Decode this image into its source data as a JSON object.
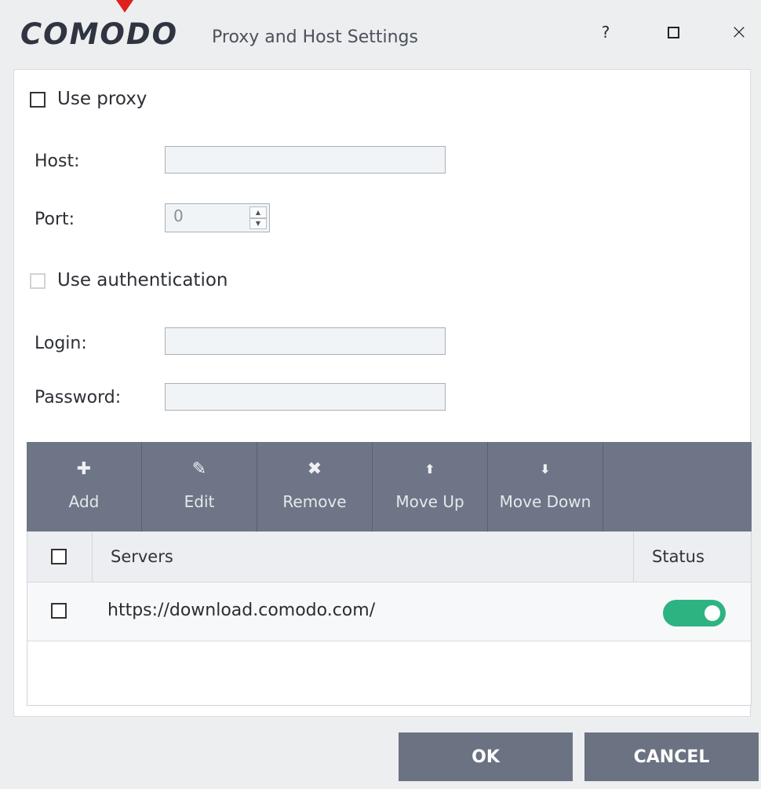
{
  "window": {
    "logo_text": "COMODO",
    "title": "Proxy and Host Settings",
    "help_label": "?",
    "close_label": "×"
  },
  "proxy": {
    "use_proxy_label": "Use proxy",
    "use_proxy_checked": false,
    "host_label": "Host:",
    "host_value": "",
    "port_label": "Port:",
    "port_value": "0",
    "use_auth_label": "Use authentication",
    "use_auth_checked": false,
    "login_label": "Login:",
    "login_value": "",
    "password_label": "Password:",
    "password_value": ""
  },
  "toolbar": {
    "items": [
      {
        "label": "Add",
        "icon": "plus-icon",
        "glyph": "✚"
      },
      {
        "label": "Edit",
        "icon": "pen-icon",
        "glyph": "✎"
      },
      {
        "label": "Remove",
        "icon": "x-icon",
        "glyph": "✖"
      },
      {
        "label": "Move Up",
        "icon": "arrow-up-icon",
        "glyph": "⬆"
      },
      {
        "label": "Move Down",
        "icon": "arrow-down-icon",
        "glyph": "⬇"
      }
    ]
  },
  "table": {
    "columns": [
      "Servers",
      "Status"
    ],
    "rows": [
      {
        "server": "https://download.comodo.com/",
        "enabled": true
      }
    ]
  },
  "buttons": {
    "ok": "OK",
    "cancel": "CANCEL"
  },
  "colors": {
    "toolbar_bg": "#6e7586",
    "button_bg": "#6b7282",
    "toggle_on": "#2db382",
    "marker_arrow": "#e0201c"
  }
}
